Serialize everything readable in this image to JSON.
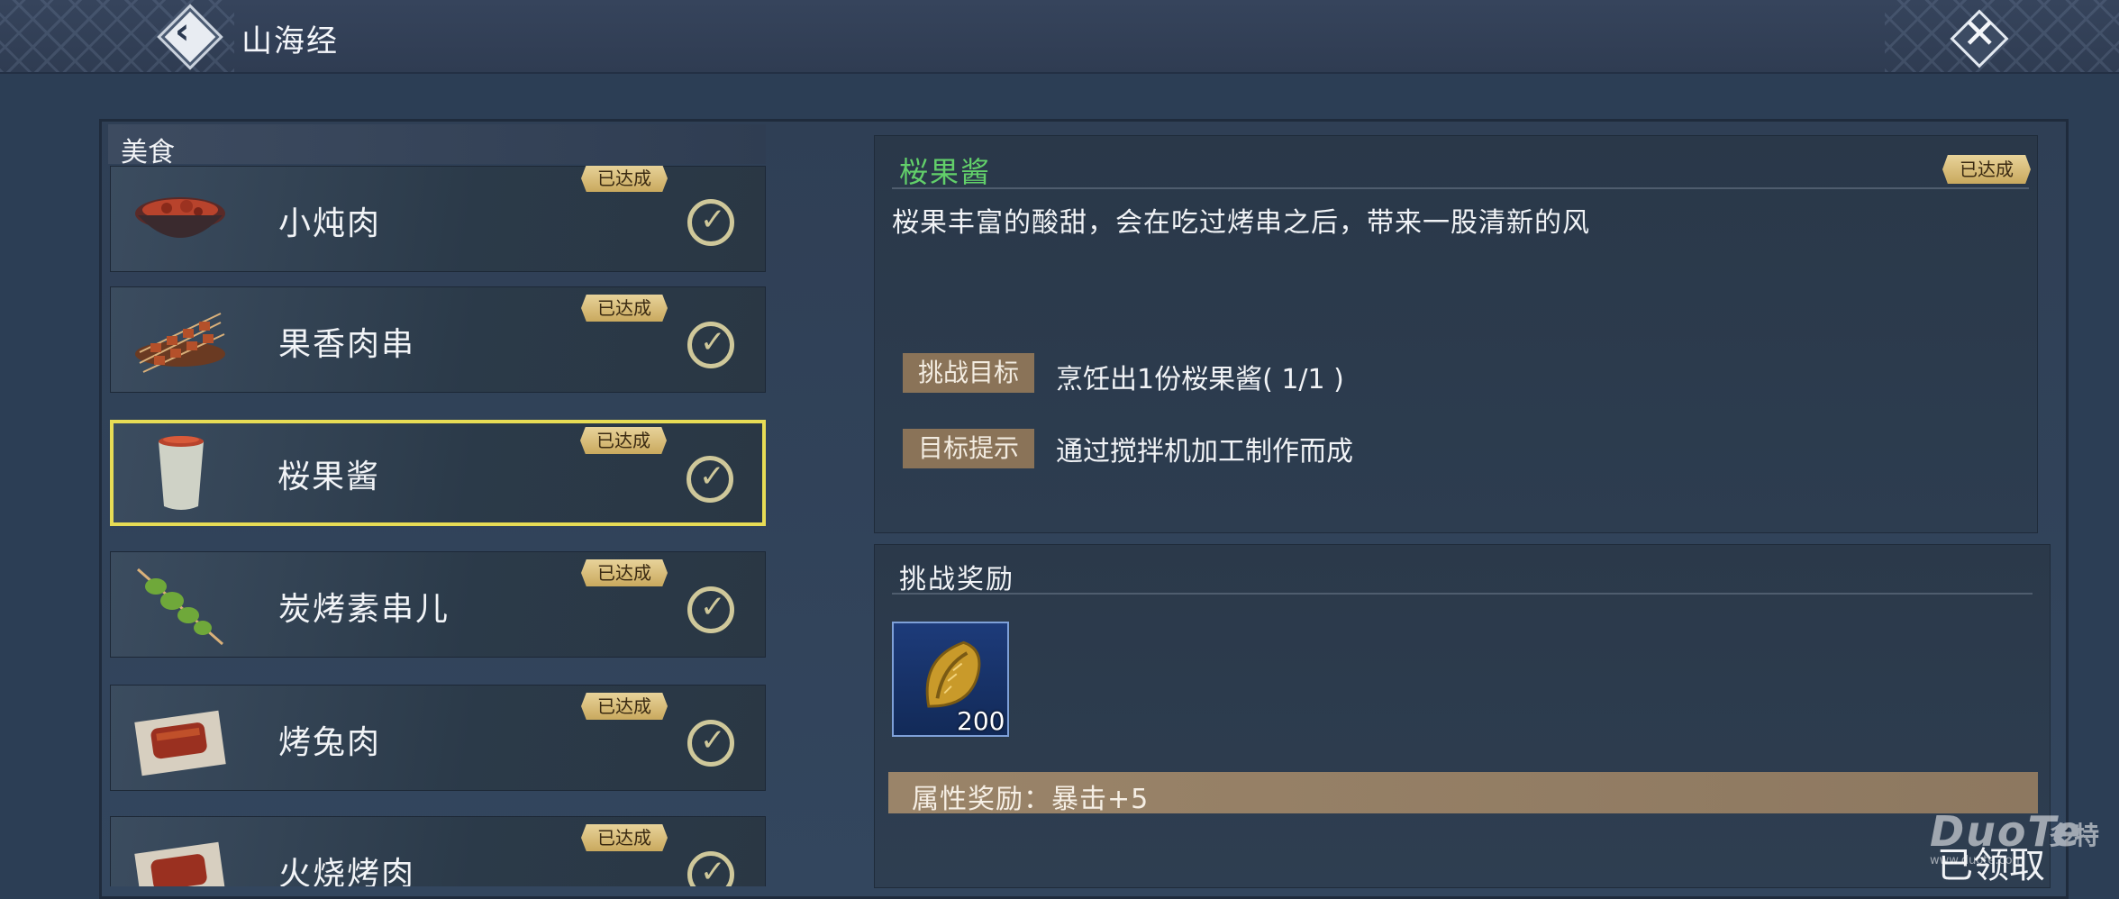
{
  "header": {
    "title": "山海经",
    "back_icon": "chevron-left-icon",
    "close_icon": "close-icon"
  },
  "category": {
    "label": "美食"
  },
  "recipes": [
    {
      "name": "小炖肉",
      "badge": "已达成",
      "completed": true,
      "icon": "stew-bowl-icon"
    },
    {
      "name": "果香肉串",
      "badge": "已达成",
      "completed": true,
      "icon": "meat-skewers-icon"
    },
    {
      "name": "桜果酱",
      "badge": "已达成",
      "completed": true,
      "icon": "jam-cup-icon",
      "selected": true
    },
    {
      "name": "炭烤素串儿",
      "badge": "已达成",
      "completed": true,
      "icon": "veggie-skewer-icon"
    },
    {
      "name": "烤兔肉",
      "badge": "已达成",
      "completed": true,
      "icon": "roast-rabbit-icon"
    },
    {
      "name": "火烧烤肉",
      "badge": "已达成",
      "completed": true,
      "icon": "grilled-meat-icon"
    }
  ],
  "detail": {
    "title": "桜果酱",
    "badge": "已达成",
    "description": "桜果丰富的酸甜，会在吃过烤串之后，带来一股清新的风",
    "challenge_goal_label": "挑战目标",
    "challenge_goal_text": "烹饪出1份桜果酱( 1/1 )",
    "hint_label": "目标提示",
    "hint_text": "通过搅拌机加工制作而成"
  },
  "reward": {
    "title": "挑战奖励",
    "item_icon": "shell-coin-icon",
    "item_count": "200",
    "attribute_text": "属性奖励：暴击+5",
    "claim_status": "已领取"
  },
  "watermark": {
    "main": "DuoTe",
    "cn": "多特",
    "url": "www.duote.com"
  },
  "colors": {
    "accent_green": "#62d06a",
    "badge_gold": "#d9bf7c",
    "selected_border": "#e7dc55",
    "tag_brown": "#8a7358"
  }
}
